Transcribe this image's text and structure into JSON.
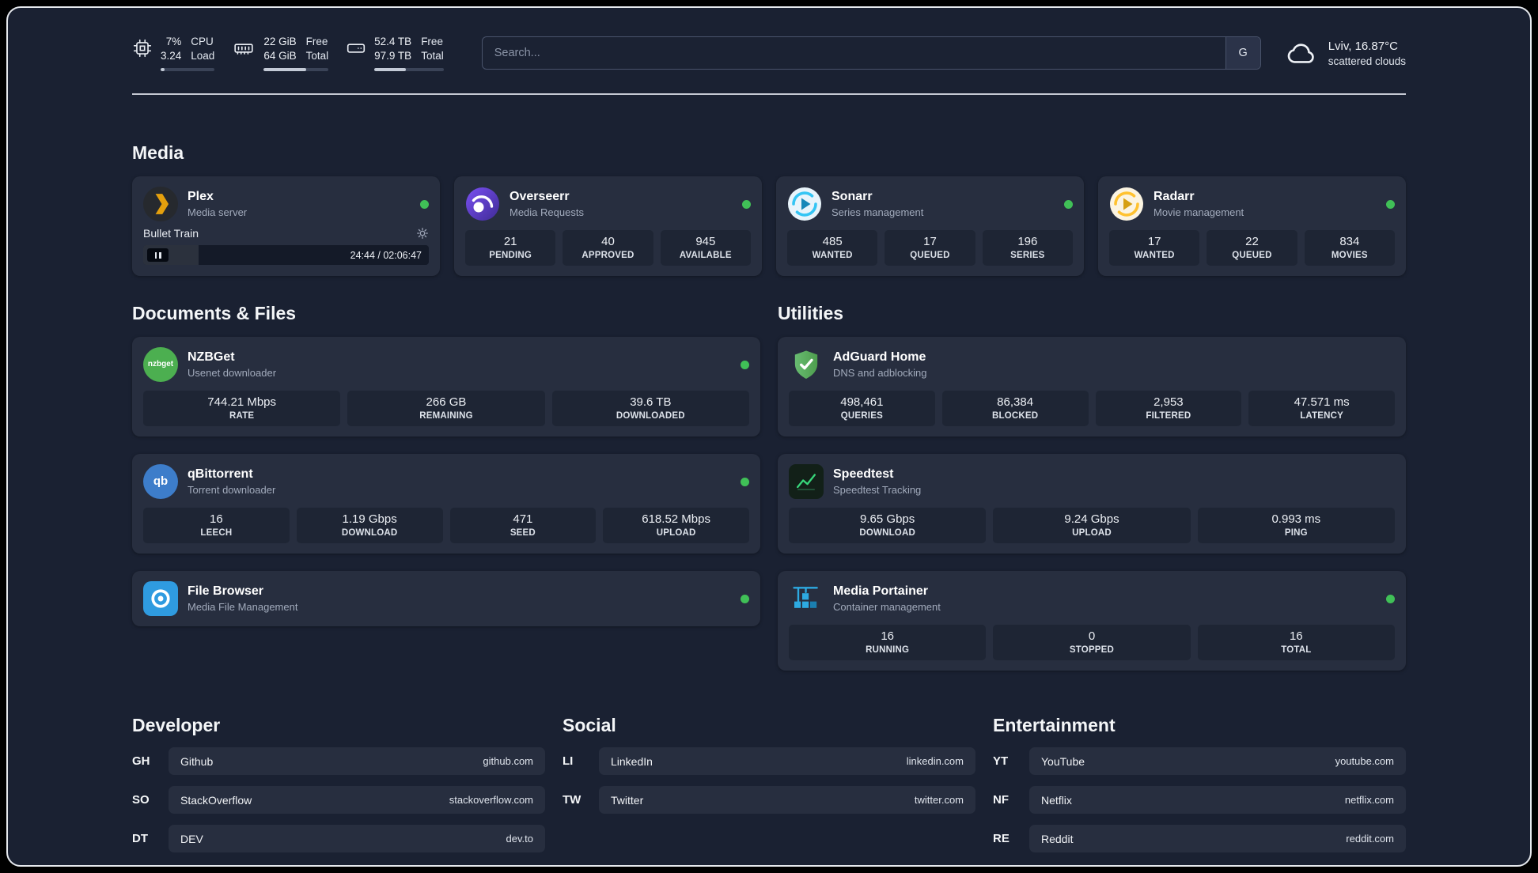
{
  "colors": {
    "background": "#1a2132",
    "card": "#272e3f",
    "stat_box": "#1e2534",
    "status_online": "#40c057",
    "plex_accent": "#e5a00d",
    "sonarr_accent": "#35c5f4",
    "radarr_accent": "#ffc230",
    "overseerr_accent": "#6a3ff0",
    "nzbget_accent": "#4caf50",
    "qbittorrent_accent": "#3d7dca",
    "adguard_accent": "#5cb85c",
    "speedtest_accent": "#37d67a",
    "portainer_accent": "#2daae2",
    "filebrowser_accent": "#2f9be0"
  },
  "header": {
    "cpu": {
      "percent": "7%",
      "load": "3.24",
      "label_top": "CPU",
      "label_bottom": "Load",
      "bar_percent": 7
    },
    "ram": {
      "free": "22 GiB",
      "total": "64 GiB",
      "label_top": "Free",
      "label_bottom": "Total",
      "bar_percent": 66
    },
    "disk": {
      "free": "52.4 TB",
      "total": "97.9 TB",
      "label_top": "Free",
      "label_bottom": "Total",
      "bar_percent": 46
    },
    "search": {
      "placeholder": "Search...",
      "engine_label": "G"
    },
    "weather": {
      "location": "Lviv, 16.87°C",
      "condition": "scattered clouds"
    }
  },
  "sections": {
    "media": {
      "title": "Media",
      "plex": {
        "name": "Plex",
        "subtitle": "Media server",
        "status": "online",
        "player": {
          "track": "Bullet Train",
          "time": "24:44 / 02:06:47",
          "progress_percent": 19.5
        }
      },
      "overseerr": {
        "name": "Overseerr",
        "subtitle": "Media Requests",
        "status": "online",
        "stats": [
          {
            "value": "21",
            "label": "PENDING"
          },
          {
            "value": "40",
            "label": "APPROVED"
          },
          {
            "value": "945",
            "label": "AVAILABLE"
          }
        ]
      },
      "sonarr": {
        "name": "Sonarr",
        "subtitle": "Series management",
        "status": "online",
        "stats": [
          {
            "value": "485",
            "label": "WANTED"
          },
          {
            "value": "17",
            "label": "QUEUED"
          },
          {
            "value": "196",
            "label": "SERIES"
          }
        ]
      },
      "radarr": {
        "name": "Radarr",
        "subtitle": "Movie management",
        "status": "online",
        "stats": [
          {
            "value": "17",
            "label": "WANTED"
          },
          {
            "value": "22",
            "label": "QUEUED"
          },
          {
            "value": "834",
            "label": "MOVIES"
          }
        ]
      }
    },
    "documents": {
      "title": "Documents & Files",
      "nzbget": {
        "name": "NZBGet",
        "subtitle": "Usenet downloader",
        "status": "online",
        "stats": [
          {
            "value": "744.21 Mbps",
            "label": "RATE"
          },
          {
            "value": "266 GB",
            "label": "REMAINING"
          },
          {
            "value": "39.6 TB",
            "label": "DOWNLOADED"
          }
        ]
      },
      "qbittorrent": {
        "name": "qBittorrent",
        "subtitle": "Torrent downloader",
        "status": "online",
        "stats": [
          {
            "value": "16",
            "label": "LEECH"
          },
          {
            "value": "1.19 Gbps",
            "label": "DOWNLOAD"
          },
          {
            "value": "471",
            "label": "SEED"
          },
          {
            "value": "618.52 Mbps",
            "label": "UPLOAD"
          }
        ]
      },
      "filebrowser": {
        "name": "File Browser",
        "subtitle": "Media File Management",
        "status": "online"
      }
    },
    "utilities": {
      "title": "Utilities",
      "adguard": {
        "name": "AdGuard Home",
        "subtitle": "DNS and adblocking",
        "stats": [
          {
            "value": "498,461",
            "label": "QUERIES"
          },
          {
            "value": "86,384",
            "label": "BLOCKED"
          },
          {
            "value": "2,953",
            "label": "FILTERED"
          },
          {
            "value": "47.571 ms",
            "label": "LATENCY"
          }
        ]
      },
      "speedtest": {
        "name": "Speedtest",
        "subtitle": "Speedtest Tracking",
        "stats": [
          {
            "value": "9.65 Gbps",
            "label": "DOWNLOAD"
          },
          {
            "value": "9.24 Gbps",
            "label": "UPLOAD"
          },
          {
            "value": "0.993 ms",
            "label": "PING"
          }
        ]
      },
      "portainer": {
        "name": "Media Portainer",
        "subtitle": "Container management",
        "status": "online",
        "stats": [
          {
            "value": "16",
            "label": "RUNNING"
          },
          {
            "value": "0",
            "label": "STOPPED"
          },
          {
            "value": "16",
            "label": "TOTAL"
          }
        ]
      }
    },
    "bookmarks": [
      {
        "title": "Developer",
        "links": [
          {
            "abbr": "GH",
            "name": "Github",
            "url": "github.com"
          },
          {
            "abbr": "SO",
            "name": "StackOverflow",
            "url": "stackoverflow.com"
          },
          {
            "abbr": "DT",
            "name": "DEV",
            "url": "dev.to"
          }
        ]
      },
      {
        "title": "Social",
        "links": [
          {
            "abbr": "LI",
            "name": "LinkedIn",
            "url": "linkedin.com"
          },
          {
            "abbr": "TW",
            "name": "Twitter",
            "url": "twitter.com"
          }
        ]
      },
      {
        "title": "Entertainment",
        "links": [
          {
            "abbr": "YT",
            "name": "YouTube",
            "url": "youtube.com"
          },
          {
            "abbr": "NF",
            "name": "Netflix",
            "url": "netflix.com"
          },
          {
            "abbr": "RE",
            "name": "Reddit",
            "url": "reddit.com"
          }
        ]
      }
    ]
  }
}
